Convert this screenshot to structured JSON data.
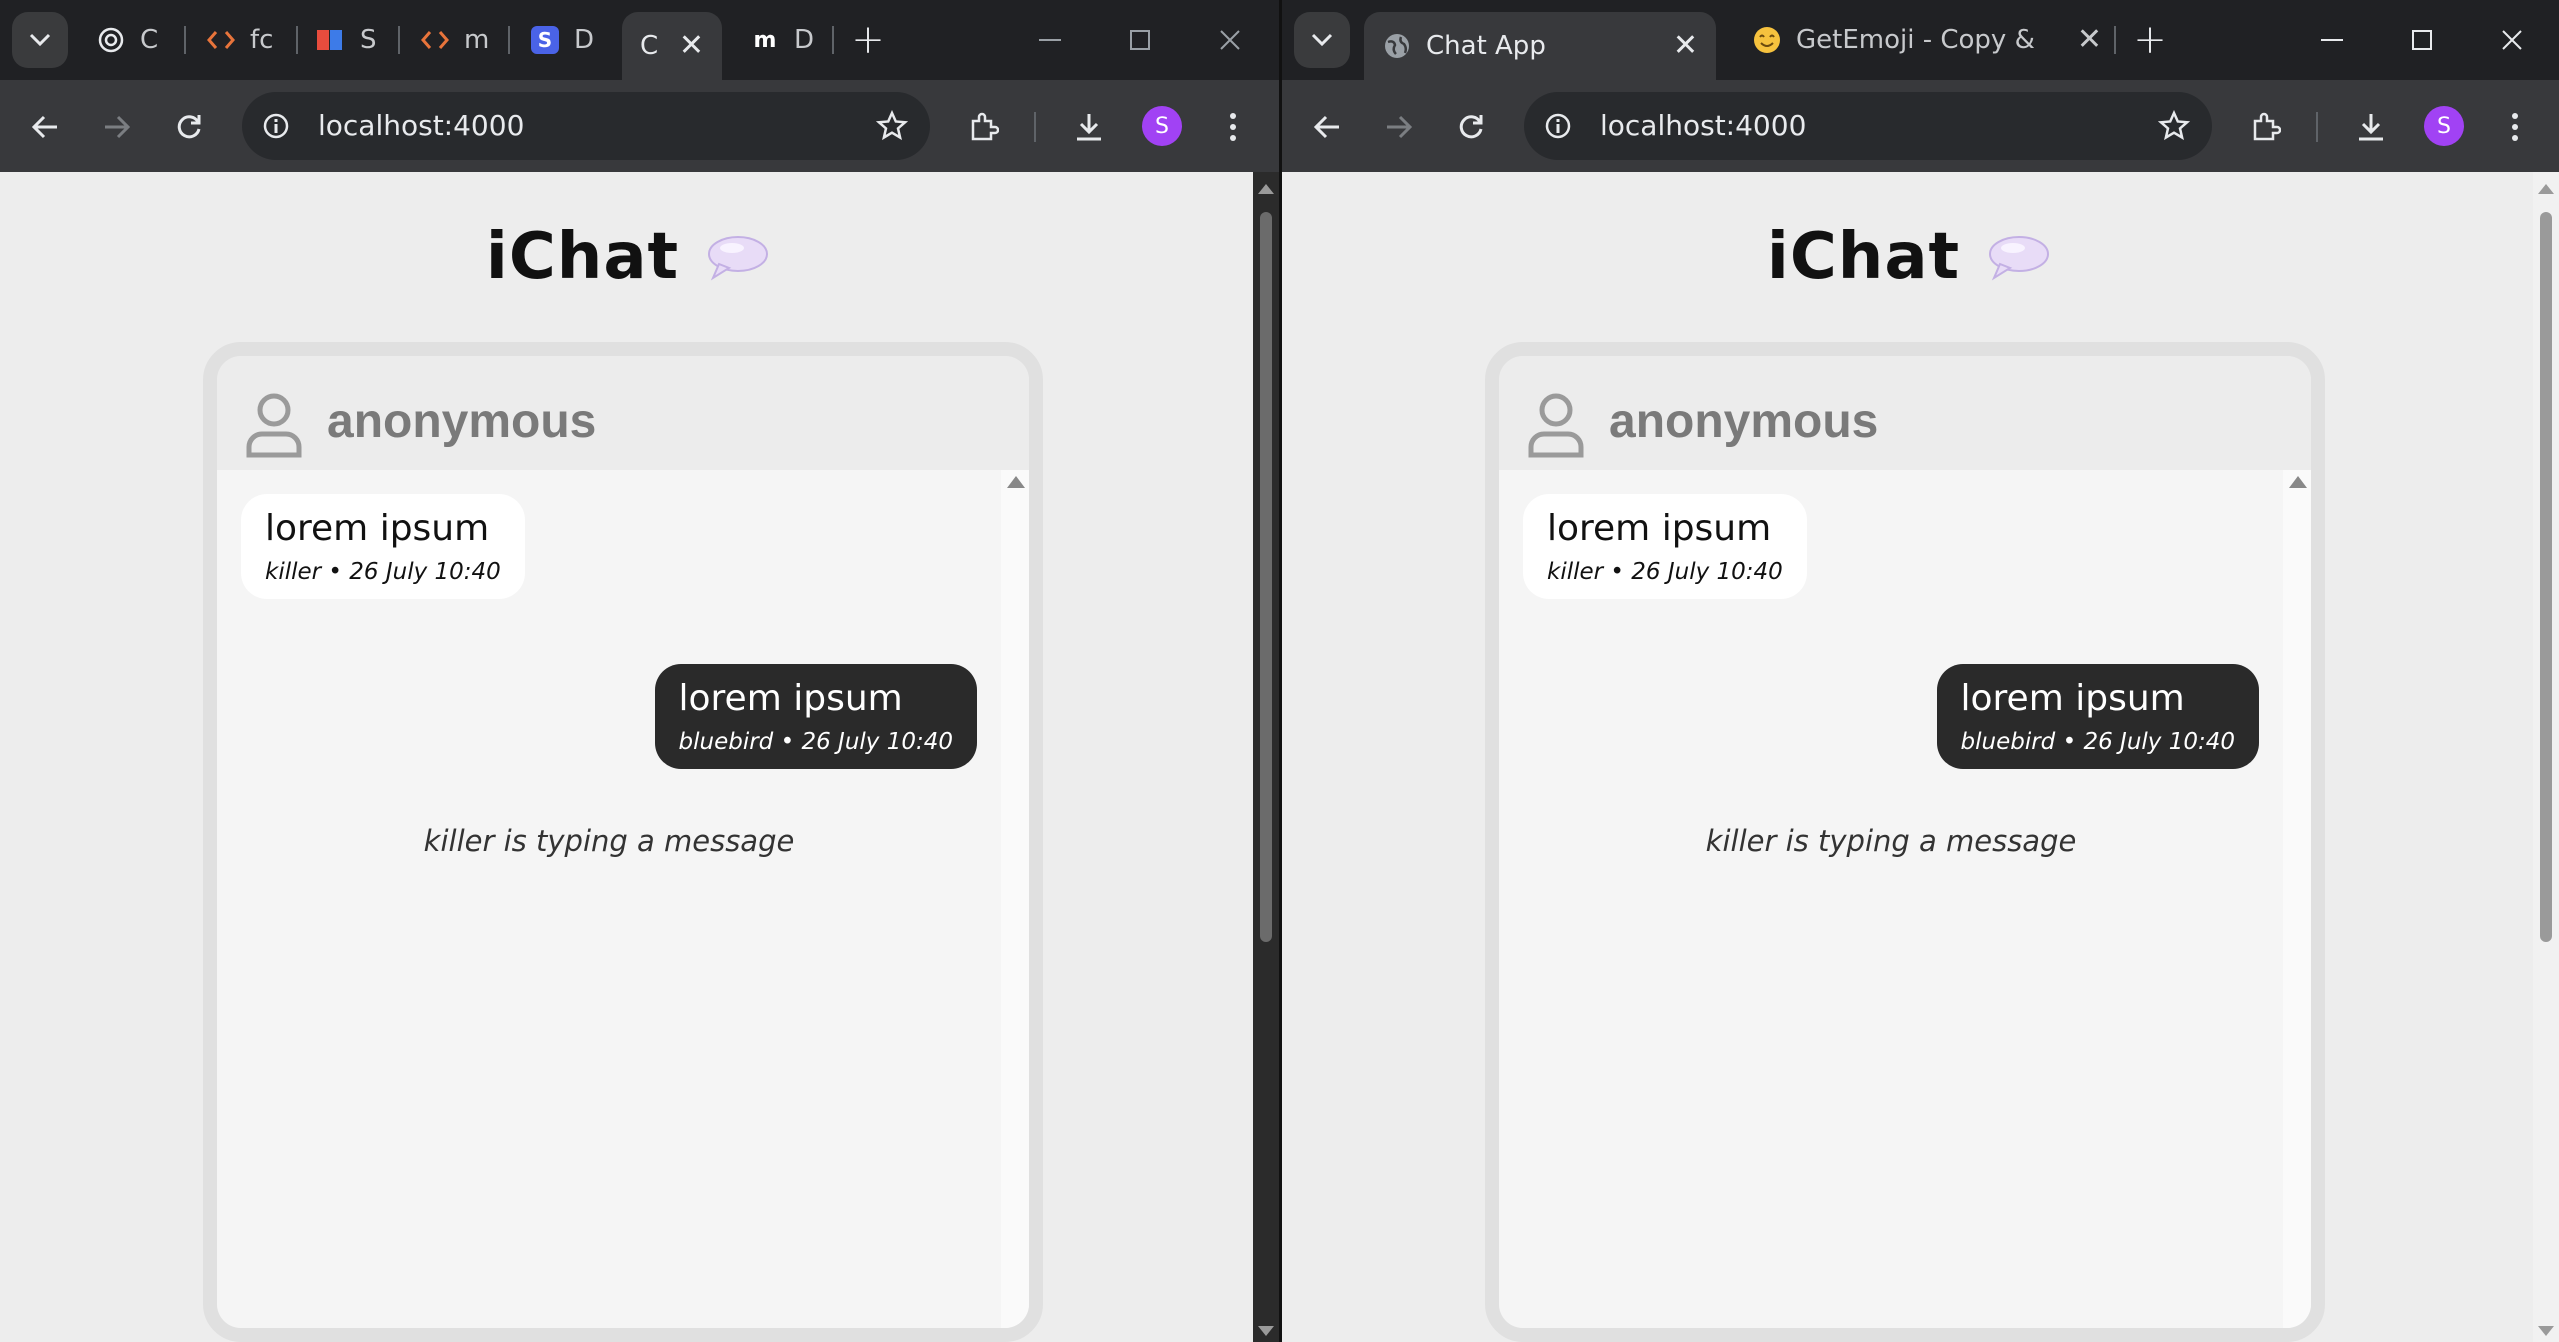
{
  "left_window": {
    "tabs": [
      {
        "title": "C"
      },
      {
        "title": "fc"
      },
      {
        "title": "S"
      },
      {
        "title": "m"
      },
      {
        "title": "D"
      },
      {
        "title": "C",
        "active": true
      },
      {
        "title": "D"
      }
    ],
    "url": "localhost:4000",
    "avatar_letter": "S"
  },
  "right_window": {
    "tabs": [
      {
        "title": "Chat App",
        "active": true
      },
      {
        "title": "GetEmoji - Copy & Pas"
      }
    ],
    "url": "localhost:4000",
    "avatar_letter": "S"
  },
  "app": {
    "title": "iChat",
    "username": "anonymous",
    "messages": [
      {
        "text": "lorem ipsum",
        "meta": "killer • 26 July 10:40",
        "direction": "in"
      },
      {
        "text": "lorem ipsum",
        "meta": "bluebird • 26 July 10:40",
        "direction": "out"
      }
    ],
    "typing": "killer is typing a message"
  },
  "colors": {
    "chrome_dark": "#202124",
    "toolbar": "#38393c",
    "page_bg": "#ededed",
    "outgoing_bubble": "#2a2a2a",
    "incoming_bubble": "#ffffff",
    "avatar": "#a142f4"
  }
}
